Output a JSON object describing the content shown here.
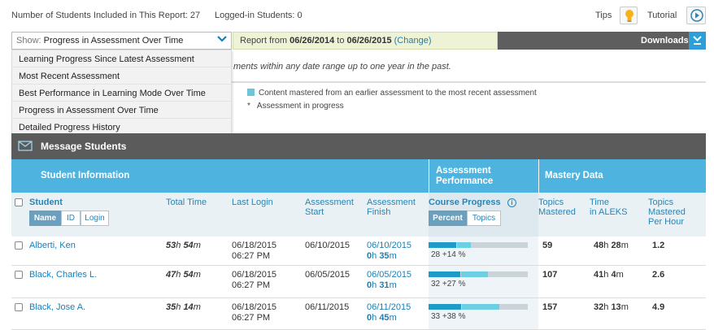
{
  "info": {
    "students_label": "Number of Students Included in This Report:",
    "students_count": "27",
    "logged_label": "Logged-in Students:",
    "logged_count": "0",
    "tips": "Tips",
    "tutorial": "Tutorial"
  },
  "show": {
    "label": "Show:",
    "value": "Progress in Assessment Over Time",
    "options": [
      "Learning Progress Since Latest Assessment",
      "Most Recent Assessment",
      "Best Performance in Learning Mode Over Time",
      "Progress in Assessment Over Time",
      "Detailed Progress History"
    ]
  },
  "report": {
    "prefix": "Report from",
    "from": "06/26/2014",
    "to_word": "to",
    "to": "06/26/2015",
    "change": "(Change)"
  },
  "downloads": "Downloads",
  "hint": "ments within any date range up to one year in the past.",
  "legend": {
    "mastered": "Content mastered from an earlier assessment to the most recent assessment",
    "star": "*",
    "in_progress": "Assessment in progress"
  },
  "message_students": "Message Students",
  "bands": {
    "student_info": "Student Information",
    "assessment_perf_1": "Assessment",
    "assessment_perf_2": "Performance",
    "mastery": "Mastery Data"
  },
  "columns": {
    "student": "Student",
    "sort_name": "Name",
    "sort_id": "ID",
    "sort_login": "Login",
    "total_time": "Total Time",
    "last_login": "Last Login",
    "assessment_start_1": "Assessment",
    "assessment_start_2": "Start",
    "assessment_finish_1": "Assessment",
    "assessment_finish_2": "Finish",
    "course_progress": "Course Progress",
    "percent": "Percent",
    "topics": "Topics",
    "topics_mastered_1": "Topics",
    "topics_mastered_2": "Mastered",
    "time_aleks_1": "Time",
    "time_aleks_2": "in ALEKS",
    "per_hour_1": "Topics",
    "per_hour_2": "Mastered",
    "per_hour_3": "Per Hour"
  },
  "rows": [
    {
      "name": "Alberti, Ken",
      "total_h": "53",
      "total_m": "54",
      "last_login_date": "06/18/2015",
      "last_login_time": "06:27 PM",
      "start": "06/10/2015",
      "finish_date": "06/10/2015",
      "finish_h": "0",
      "finish_m": "35",
      "progress_base": 28,
      "progress_gain": 14,
      "progress_label": "28 +14 %",
      "topics_mastered": "59",
      "aleks_h": "48",
      "aleks_m": "28",
      "per_hour": "1.2"
    },
    {
      "name": "Black, Charles L.",
      "total_h": "47",
      "total_m": "54",
      "last_login_date": "06/18/2015",
      "last_login_time": "06:27 PM",
      "start": "06/05/2015",
      "finish_date": "06/05/2015",
      "finish_h": "0",
      "finish_m": "31",
      "progress_base": 32,
      "progress_gain": 27,
      "progress_label": "32 +27 %",
      "topics_mastered": "107",
      "aleks_h": "41",
      "aleks_m": "4",
      "per_hour": "2.6"
    },
    {
      "name": "Black, Jose A.",
      "total_h": "35",
      "total_m": "14",
      "last_login_date": "06/18/2015",
      "last_login_time": "06:27 PM",
      "start": "06/11/2015",
      "finish_date": "06/11/2015",
      "finish_h": "0",
      "finish_m": "45",
      "progress_base": 33,
      "progress_gain": 38,
      "progress_label": "33 +38 %",
      "topics_mastered": "157",
      "aleks_h": "32",
      "aleks_m": "13",
      "per_hour": "4.9"
    }
  ],
  "units": {
    "h": "h",
    "m": "m"
  },
  "colors": {
    "accent_blue": "#4fb3e0",
    "link_blue": "#1a7fb5",
    "bar_dark": "#1e9bc7",
    "bar_light": "#6dcfe2",
    "dark_bar": "#5b5b5b"
  }
}
